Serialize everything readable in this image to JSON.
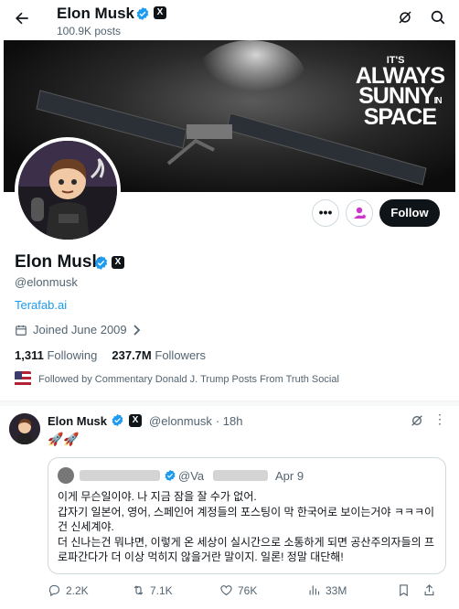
{
  "header": {
    "title": "Elon Musk",
    "posts_count": "100.9K posts",
    "x_badge": "X"
  },
  "banner": {
    "line1": "IT'S",
    "line2": "ALWAYS",
    "line3": "SUNNY",
    "line3_small": "IN",
    "line4": "SPACE"
  },
  "profile": {
    "name": "Elon Musk",
    "handle": "@elonmusk",
    "link": "Terafab.ai",
    "joined": "Joined June 2009",
    "following_count": "1,311",
    "following_label": "Following",
    "followers_count": "237.7M",
    "followers_label": "Followers",
    "followed_by": "Followed by Commentary Donald J. Trump Posts From Truth Social",
    "follow_button": "Follow",
    "more_button": "•••"
  },
  "tweet": {
    "author": "Elon Musk",
    "handle": "@elonmusk",
    "time": "· 18h",
    "text": "🚀🚀",
    "quote": {
      "handle": "@Va",
      "date": "Apr 9",
      "line1": "이게 무슨일이야. 나 지금 잠을 잘 수가 없어.",
      "line2": "갑자기 일본어, 영어, 스페인어 계정들의 포스팅이 막 한국어로 보이는거야 ㅋㅋㅋ이",
      "line3": "건 신세계야.",
      "line4": "더 신나는건 뭐냐면, 이렇게 온 세상이 실시간으로 소통하게 되면 공산주의자들의 프",
      "line5": "로파간다가 더 이상 먹히지 않을거란 말이지. 일론! 정말 대단해!"
    },
    "replies": "2.2K",
    "reposts": "7.1K",
    "likes": "76K",
    "views": "33M"
  },
  "colors": {
    "accent": "#1d9bf0",
    "text": "#0f1419",
    "muted": "#536471",
    "border": "#cfd9de"
  }
}
